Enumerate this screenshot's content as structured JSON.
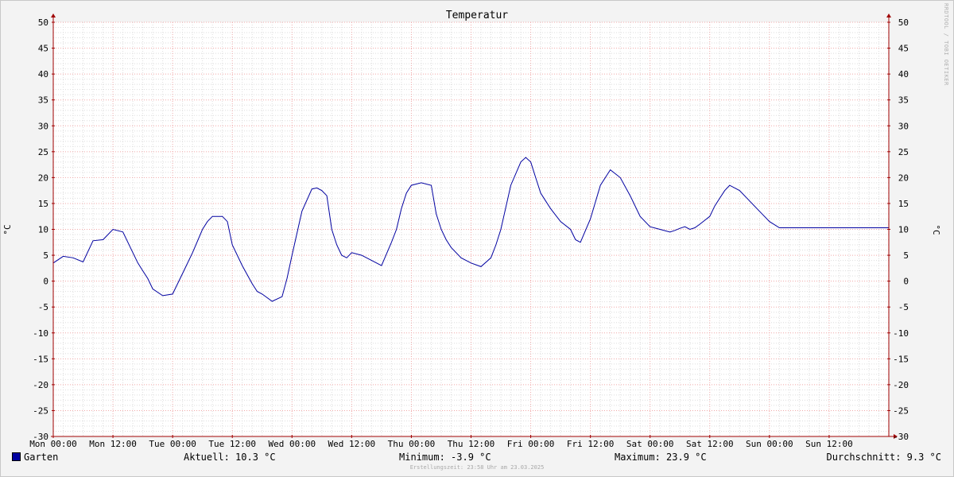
{
  "chart_data": {
    "type": "line",
    "title": "Temperatur",
    "ylabel": "°C",
    "ylabel_right": "°C",
    "ylim": [
      -30,
      50
    ],
    "yticks": [
      -30,
      -25,
      -20,
      -15,
      -10,
      -5,
      0,
      5,
      10,
      15,
      20,
      25,
      30,
      35,
      40,
      45,
      50
    ],
    "xlim": [
      0,
      168
    ],
    "xtick_hours": [
      0,
      12,
      24,
      36,
      48,
      60,
      72,
      84,
      96,
      108,
      120,
      132,
      144,
      156
    ],
    "xtick_labels": [
      "Mon 00:00",
      "Mon 12:00",
      "Tue 00:00",
      "Tue 12:00",
      "Wed 00:00",
      "Wed 12:00",
      "Thu 00:00",
      "Thu 12:00",
      "Fri 00:00",
      "Fri 12:00",
      "Sat 00:00",
      "Sat 12:00",
      "Sun 00:00",
      "Sun 12:00"
    ],
    "x_unit": "hours since Mon 00:00",
    "grid": true,
    "series": [
      {
        "name": "Garten",
        "color": "#0000a0",
        "x": [
          0,
          2,
          4,
          6,
          8,
          10,
          12,
          14,
          16,
          17,
          18,
          19,
          20,
          22,
          24,
          26,
          28,
          30,
          31,
          32,
          34,
          35,
          36,
          38,
          40,
          41,
          42,
          44,
          46,
          47,
          48,
          50,
          52,
          53,
          54,
          55,
          56,
          57,
          58,
          59,
          60,
          62,
          64,
          66,
          68,
          69,
          70,
          71,
          72,
          74,
          76,
          77,
          78,
          79,
          80,
          82,
          84,
          86,
          88,
          89,
          90,
          92,
          94,
          95,
          96,
          97,
          98,
          99,
          100,
          102,
          104,
          105,
          106,
          108,
          110,
          112,
          114,
          116,
          118,
          120,
          122,
          124,
          125,
          126,
          127,
          128,
          129,
          130,
          132,
          133,
          134,
          135,
          136,
          138,
          140,
          142,
          143,
          144,
          146,
          148,
          150,
          152,
          154,
          155,
          156,
          157,
          158,
          160,
          162,
          164,
          166,
          168
        ],
        "y": [
          3.5,
          4.8,
          4.5,
          3.7,
          7.8,
          8.0,
          10.0,
          9.5,
          5.5,
          3.5,
          2.0,
          0.5,
          -1.5,
          -2.8,
          -2.5,
          1.5,
          5.5,
          10.0,
          11.5,
          12.5,
          12.5,
          11.5,
          7.0,
          3.0,
          -0.5,
          -2.0,
          -2.5,
          -3.9,
          -3.0,
          0.5,
          5.0,
          13.5,
          17.8,
          18.0,
          17.5,
          16.5,
          10.0,
          7.0,
          5.0,
          4.5,
          5.5,
          5.0,
          4.0,
          3.0,
          7.5,
          10.0,
          14.0,
          17.0,
          18.5,
          19.0,
          18.5,
          13.0,
          10.0,
          8.0,
          6.5,
          4.5,
          3.5,
          2.8,
          4.5,
          7.0,
          10.0,
          18.5,
          23.0,
          23.9,
          23.0,
          20.0,
          17.0,
          15.5,
          14.0,
          11.5,
          10.0,
          8.0,
          7.5,
          12.0,
          18.5,
          21.5,
          20.0,
          16.5,
          12.5,
          10.5,
          10.0,
          9.5,
          9.8,
          10.2,
          10.5,
          10.0,
          10.3,
          11.0,
          12.5,
          14.5,
          16.0,
          17.5,
          18.5,
          17.5,
          15.5,
          13.5,
          12.5,
          11.5,
          10.3,
          10.3,
          10.3,
          10.3,
          10.3,
          10.3,
          10.3,
          10.3,
          10.3,
          10.3,
          10.3,
          10.3,
          10.3,
          10.3
        ]
      }
    ]
  },
  "legend": {
    "series_name": "Garten",
    "current": "Aktuell: 10.3 °C",
    "minimum": "Minimum: -3.9 °C",
    "maximum": "Maximum: 23.9 °C",
    "average": "Durchschnitt: 9.3 °C"
  },
  "credit": "Erstellungszeit: 23:58 Uhr am 23.03.2025",
  "watermark": "RRDTOOL / TOBI OETIKER"
}
